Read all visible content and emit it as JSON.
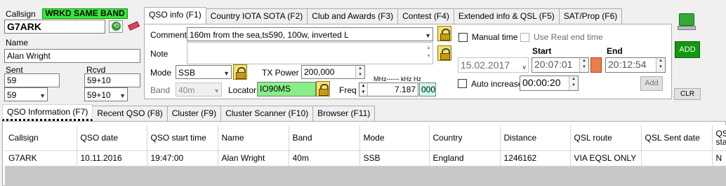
{
  "left": {
    "callsign_label": "Callsign",
    "wrkd_badge": "WRKD SAME BAND",
    "callsign_value": "G7ARK",
    "name_label": "Name",
    "name_value": "Alan Wright",
    "sent_label": "Sent",
    "rcvd_label": "Rcvd",
    "sent_value": "59",
    "rcvd_value": "59+10",
    "sent_combo": "59",
    "rcvd_combo": "59+10"
  },
  "tabs": [
    {
      "label": "QSO info (F1)"
    },
    {
      "label": "Country IOTA SOTA (F2)"
    },
    {
      "label": "Club and Awards (F3)"
    },
    {
      "label": "Contest (F4)"
    },
    {
      "label": "Extended info & QSL (F5)"
    },
    {
      "label": "SAT/Prop (F6)"
    }
  ],
  "qso": {
    "comment_label": "Comment",
    "comment_value": "160m from the sea,ts590, 100w, inverted L",
    "note_label": "Note",
    "note_value": "",
    "mode_label": "Mode",
    "mode_value": "SSB",
    "band_label": "Band",
    "band_value": "40m",
    "txpower_label": "TX Power",
    "txpower_value": "200,000",
    "locator_label": "Locator",
    "locator_value": "IO90MS",
    "freq_label": "Freq",
    "freq_unit_label": "MHz------ kHz   Hz",
    "freq_value": "7.187",
    "freq_hz_value": "000"
  },
  "time": {
    "manual_time_label": "Manual time",
    "real_end_label": "Use Real end time",
    "start_label": "Start",
    "end_label": "End",
    "date_value": "15.02.2017",
    "start_value": "20:07:01",
    "end_value": "20:12:54",
    "auto_increase_label": "Auto increase",
    "auto_increase_value": "00:00:20",
    "add_small_label": "Add"
  },
  "right": {
    "add_label": "ADD",
    "clr_label": "CLR"
  },
  "bottom_tabs": [
    {
      "label": "QSO Information (F7)"
    },
    {
      "label": "Recent QSO (F8)"
    },
    {
      "label": "Cluster (F9)"
    },
    {
      "label": "Cluster Scanner (F10)"
    },
    {
      "label": "Browser (F11)"
    }
  ],
  "table": {
    "headers": [
      "Callsign",
      "QSO date",
      "QSO start time",
      "Name",
      "Band",
      "Mode",
      "Country",
      "Distance",
      "QSL route",
      "QSL Sent date",
      "QSL status"
    ],
    "rows": [
      [
        "G7ARK",
        "10.11.2016",
        "19:47:00",
        "Alan Wright",
        "40m",
        "SSB",
        "England",
        "1246162",
        "VIA EQSL ONLY",
        "",
        "N"
      ]
    ]
  },
  "colors": {
    "badge_bg": "#33ee33",
    "locator_bg": "#88ee88",
    "add_button_bg": "#119911",
    "time_marker": "#f07a4a",
    "table_empty": "#c8c8c8"
  }
}
